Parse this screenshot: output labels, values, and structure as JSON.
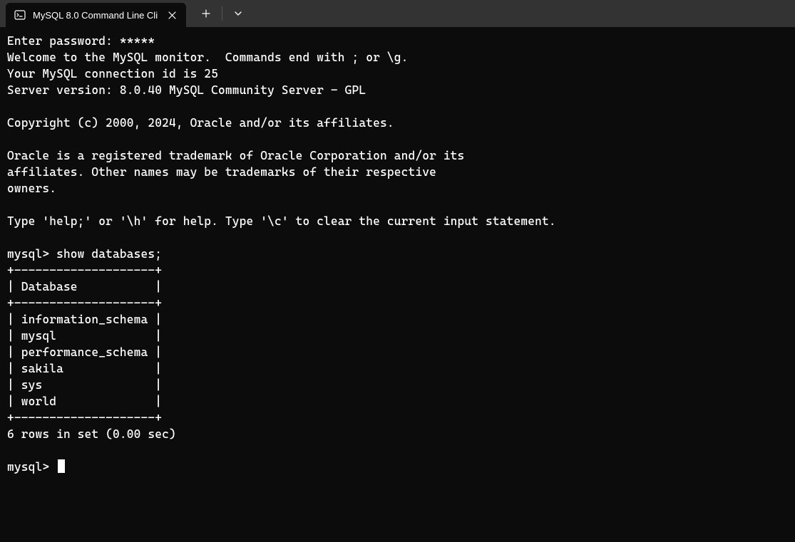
{
  "titlebar": {
    "tab_title": "MySQL 8.0 Command Line Cli"
  },
  "terminal": {
    "password_prompt": "Enter password: *****",
    "welcome": "Welcome to the MySQL monitor.  Commands end with ; or \\g.",
    "connection_id": "Your MySQL connection id is 25",
    "server_version": "Server version: 8.0.40 MySQL Community Server - GPL",
    "copyright": "Copyright (c) 2000, 2024, Oracle and/or its affiliates.",
    "trademark1": "Oracle is a registered trademark of Oracle Corporation and/or its",
    "trademark2": "affiliates. Other names may be trademarks of their respective",
    "trademark3": "owners.",
    "help_hint": "Type 'help;' or '\\h' for help. Type '\\c' to clear the current input statement.",
    "prompt1": "mysql> show databases;",
    "table_border": "+--------------------+",
    "table_header": "| Database           |",
    "row1": "| information_schema |",
    "row2": "| mysql              |",
    "row3": "| performance_schema |",
    "row4": "| sakila             |",
    "row5": "| sys                |",
    "row6": "| world              |",
    "result_summary": "6 rows in set (0.00 sec)",
    "prompt2": "mysql> "
  }
}
